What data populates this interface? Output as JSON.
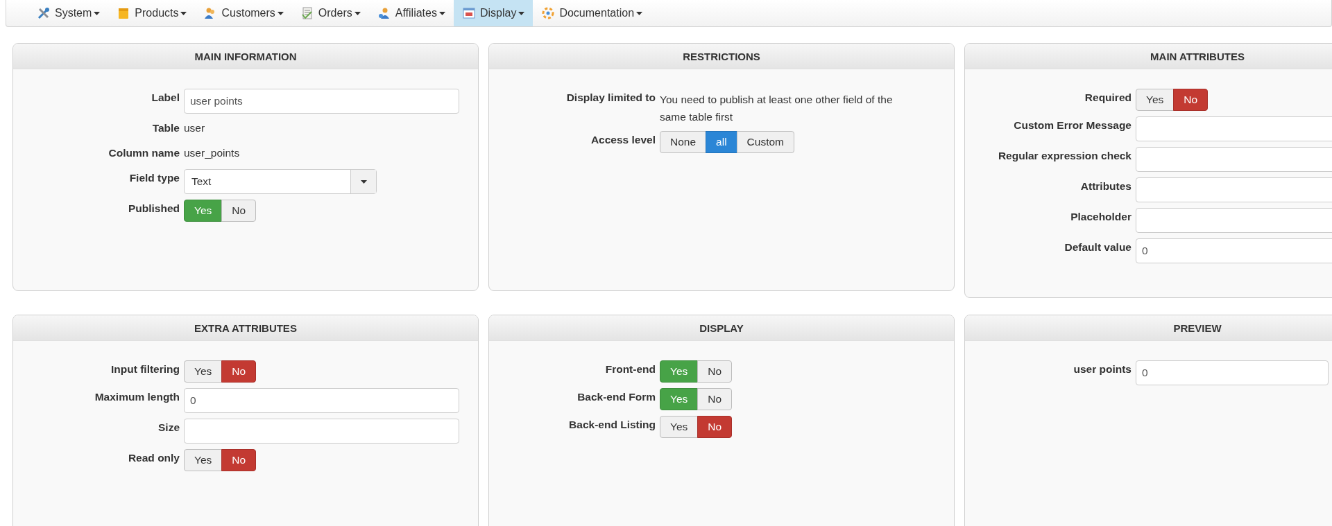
{
  "menu": [
    {
      "label": "System",
      "selected": false
    },
    {
      "label": "Products",
      "selected": false
    },
    {
      "label": "Customers",
      "selected": false
    },
    {
      "label": "Orders",
      "selected": false
    },
    {
      "label": "Affiliates",
      "selected": false
    },
    {
      "label": "Display",
      "selected": true
    },
    {
      "label": "Documentation",
      "selected": false
    }
  ],
  "panels": [
    {
      "title": "MAIN INFORMATION",
      "rows": [
        {
          "kind": "input",
          "label": "Label",
          "value": "user points"
        },
        {
          "kind": "static",
          "label": "Table",
          "value": "user"
        },
        {
          "kind": "static",
          "label": "Column name",
          "value": "user_points"
        },
        {
          "kind": "select",
          "label": "Field type",
          "value": "Text"
        },
        {
          "kind": "yesno",
          "label": "Published",
          "options": [
            {
              "label": "Yes",
              "selected": true
            },
            {
              "label": "No",
              "selected": false
            }
          ]
        }
      ]
    },
    {
      "title": "RESTRICTIONS",
      "rows": [
        {
          "kind": "note",
          "label": "Display limited to",
          "value": "You need to publish at least one other field of the same table first"
        },
        {
          "kind": "choice",
          "label": "Access level",
          "options": [
            {
              "label": "None",
              "selected": false
            },
            {
              "label": "all",
              "selected": true
            },
            {
              "label": "Custom",
              "selected": false
            }
          ]
        }
      ]
    },
    {
      "title": "MAIN ATTRIBUTES",
      "rows": [
        {
          "kind": "yesno",
          "label": "Required",
          "options": [
            {
              "label": "Yes",
              "selected": false
            },
            {
              "label": "No",
              "selected": true
            }
          ]
        },
        {
          "kind": "input",
          "label": "Custom Error Message"
        },
        {
          "kind": "input",
          "label": "Regular expression check"
        },
        {
          "kind": "input",
          "label": "Attributes"
        },
        {
          "kind": "input",
          "label": "Placeholder"
        },
        {
          "kind": "input",
          "label": "Default value",
          "value": "0"
        }
      ]
    },
    {
      "title": "EXTRA ATTRIBUTES",
      "rows": [
        {
          "kind": "yesno",
          "label": "Input filtering",
          "options": [
            {
              "label": "Yes",
              "selected": false
            },
            {
              "label": "No",
              "selected": true
            }
          ]
        },
        {
          "kind": "input",
          "label": "Maximum length",
          "value": "0"
        },
        {
          "kind": "input",
          "label": "Size"
        },
        {
          "kind": "yesno",
          "label": "Read only",
          "options": [
            {
              "label": "Yes",
              "selected": false
            },
            {
              "label": "No",
              "selected": true
            }
          ]
        }
      ]
    },
    {
      "title": "DISPLAY",
      "rows": [
        {
          "kind": "yesno",
          "label": "Front-end",
          "options": [
            {
              "label": "Yes",
              "selected": true
            },
            {
              "label": "No",
              "selected": false
            }
          ]
        },
        {
          "kind": "yesno",
          "label": "Back-end Form",
          "options": [
            {
              "label": "Yes",
              "selected": true
            },
            {
              "label": "No",
              "selected": false
            }
          ]
        },
        {
          "kind": "yesno",
          "label": "Back-end Listing",
          "options": [
            {
              "label": "Yes",
              "selected": false
            },
            {
              "label": "No",
              "selected": true
            }
          ]
        }
      ]
    },
    {
      "title": "PREVIEW",
      "rows": [
        {
          "kind": "input",
          "label": "user points",
          "value": "0"
        }
      ]
    }
  ]
}
